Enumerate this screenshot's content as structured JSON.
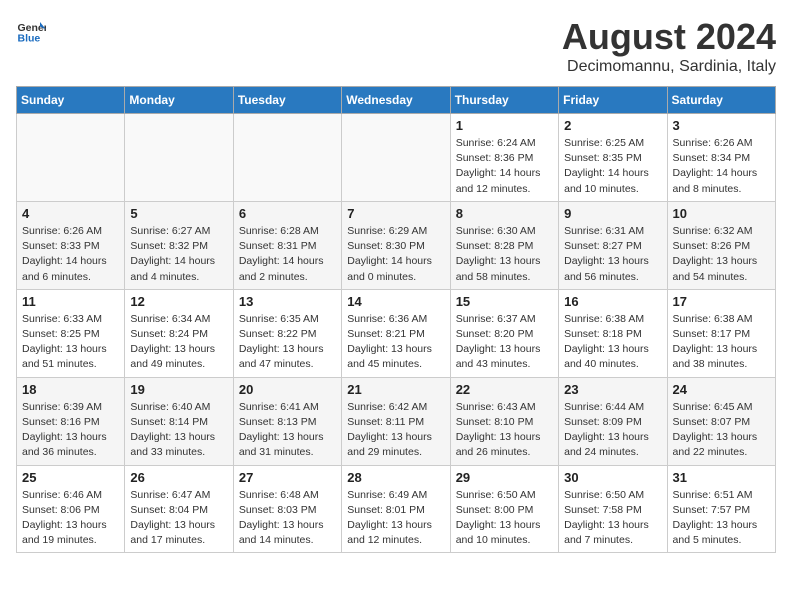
{
  "logo": {
    "general": "General",
    "blue": "Blue"
  },
  "title": "August 2024",
  "subtitle": "Decimomannu, Sardinia, Italy",
  "days_of_week": [
    "Sunday",
    "Monday",
    "Tuesday",
    "Wednesday",
    "Thursday",
    "Friday",
    "Saturday"
  ],
  "weeks": [
    [
      {
        "day": "",
        "info": ""
      },
      {
        "day": "",
        "info": ""
      },
      {
        "day": "",
        "info": ""
      },
      {
        "day": "",
        "info": ""
      },
      {
        "day": "1",
        "info": "Sunrise: 6:24 AM\nSunset: 8:36 PM\nDaylight: 14 hours\nand 12 minutes."
      },
      {
        "day": "2",
        "info": "Sunrise: 6:25 AM\nSunset: 8:35 PM\nDaylight: 14 hours\nand 10 minutes."
      },
      {
        "day": "3",
        "info": "Sunrise: 6:26 AM\nSunset: 8:34 PM\nDaylight: 14 hours\nand 8 minutes."
      }
    ],
    [
      {
        "day": "4",
        "info": "Sunrise: 6:26 AM\nSunset: 8:33 PM\nDaylight: 14 hours\nand 6 minutes."
      },
      {
        "day": "5",
        "info": "Sunrise: 6:27 AM\nSunset: 8:32 PM\nDaylight: 14 hours\nand 4 minutes."
      },
      {
        "day": "6",
        "info": "Sunrise: 6:28 AM\nSunset: 8:31 PM\nDaylight: 14 hours\nand 2 minutes."
      },
      {
        "day": "7",
        "info": "Sunrise: 6:29 AM\nSunset: 8:30 PM\nDaylight: 14 hours\nand 0 minutes."
      },
      {
        "day": "8",
        "info": "Sunrise: 6:30 AM\nSunset: 8:28 PM\nDaylight: 13 hours\nand 58 minutes."
      },
      {
        "day": "9",
        "info": "Sunrise: 6:31 AM\nSunset: 8:27 PM\nDaylight: 13 hours\nand 56 minutes."
      },
      {
        "day": "10",
        "info": "Sunrise: 6:32 AM\nSunset: 8:26 PM\nDaylight: 13 hours\nand 54 minutes."
      }
    ],
    [
      {
        "day": "11",
        "info": "Sunrise: 6:33 AM\nSunset: 8:25 PM\nDaylight: 13 hours\nand 51 minutes."
      },
      {
        "day": "12",
        "info": "Sunrise: 6:34 AM\nSunset: 8:24 PM\nDaylight: 13 hours\nand 49 minutes."
      },
      {
        "day": "13",
        "info": "Sunrise: 6:35 AM\nSunset: 8:22 PM\nDaylight: 13 hours\nand 47 minutes."
      },
      {
        "day": "14",
        "info": "Sunrise: 6:36 AM\nSunset: 8:21 PM\nDaylight: 13 hours\nand 45 minutes."
      },
      {
        "day": "15",
        "info": "Sunrise: 6:37 AM\nSunset: 8:20 PM\nDaylight: 13 hours\nand 43 minutes."
      },
      {
        "day": "16",
        "info": "Sunrise: 6:38 AM\nSunset: 8:18 PM\nDaylight: 13 hours\nand 40 minutes."
      },
      {
        "day": "17",
        "info": "Sunrise: 6:38 AM\nSunset: 8:17 PM\nDaylight: 13 hours\nand 38 minutes."
      }
    ],
    [
      {
        "day": "18",
        "info": "Sunrise: 6:39 AM\nSunset: 8:16 PM\nDaylight: 13 hours\nand 36 minutes."
      },
      {
        "day": "19",
        "info": "Sunrise: 6:40 AM\nSunset: 8:14 PM\nDaylight: 13 hours\nand 33 minutes."
      },
      {
        "day": "20",
        "info": "Sunrise: 6:41 AM\nSunset: 8:13 PM\nDaylight: 13 hours\nand 31 minutes."
      },
      {
        "day": "21",
        "info": "Sunrise: 6:42 AM\nSunset: 8:11 PM\nDaylight: 13 hours\nand 29 minutes."
      },
      {
        "day": "22",
        "info": "Sunrise: 6:43 AM\nSunset: 8:10 PM\nDaylight: 13 hours\nand 26 minutes."
      },
      {
        "day": "23",
        "info": "Sunrise: 6:44 AM\nSunset: 8:09 PM\nDaylight: 13 hours\nand 24 minutes."
      },
      {
        "day": "24",
        "info": "Sunrise: 6:45 AM\nSunset: 8:07 PM\nDaylight: 13 hours\nand 22 minutes."
      }
    ],
    [
      {
        "day": "25",
        "info": "Sunrise: 6:46 AM\nSunset: 8:06 PM\nDaylight: 13 hours\nand 19 minutes."
      },
      {
        "day": "26",
        "info": "Sunrise: 6:47 AM\nSunset: 8:04 PM\nDaylight: 13 hours\nand 17 minutes."
      },
      {
        "day": "27",
        "info": "Sunrise: 6:48 AM\nSunset: 8:03 PM\nDaylight: 13 hours\nand 14 minutes."
      },
      {
        "day": "28",
        "info": "Sunrise: 6:49 AM\nSunset: 8:01 PM\nDaylight: 13 hours\nand 12 minutes."
      },
      {
        "day": "29",
        "info": "Sunrise: 6:50 AM\nSunset: 8:00 PM\nDaylight: 13 hours\nand 10 minutes."
      },
      {
        "day": "30",
        "info": "Sunrise: 6:50 AM\nSunset: 7:58 PM\nDaylight: 13 hours\nand 7 minutes."
      },
      {
        "day": "31",
        "info": "Sunrise: 6:51 AM\nSunset: 7:57 PM\nDaylight: 13 hours\nand 5 minutes."
      }
    ]
  ]
}
